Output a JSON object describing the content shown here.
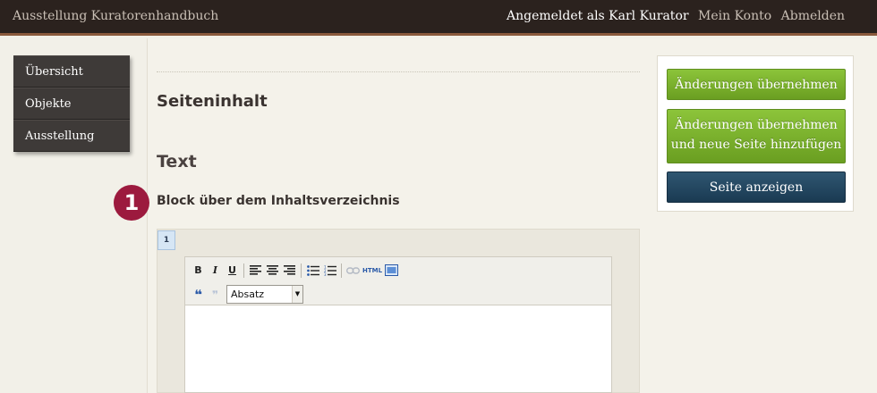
{
  "header": {
    "site_title": "Ausstellung Kuratorenhandbuch",
    "logged_in": "Angemeldet als Karl Kurator",
    "account_link": "Mein Konto",
    "logout_link": "Abmelden"
  },
  "sidebar": {
    "items": [
      {
        "label": "Übersicht"
      },
      {
        "label": "Objekte"
      },
      {
        "label": "Ausstellung"
      }
    ]
  },
  "main": {
    "section_title": "Seiteninhalt",
    "sub_title": "Text",
    "step_number": "1",
    "block_label": "Block über dem Inhaltsverzeichnis",
    "block_number": "1"
  },
  "editor": {
    "toolbar": {
      "bold": "B",
      "italic": "I",
      "underline": "U",
      "html": "HTML",
      "quote": "❝",
      "unquote": "❞"
    },
    "format_select": "Absatz"
  },
  "actions": {
    "save_label": "Änderungen übernehmen",
    "save_new_label_line1": "Änderungen übernehmen",
    "save_new_label_line2": "und neue Seite hinzufügen",
    "view_label": "Seite anzeigen"
  },
  "colors": {
    "topbar": "#2b221e",
    "accent_green": "#7bb32e",
    "accent_blue": "#1f4560",
    "badge": "#9c1a3e"
  }
}
